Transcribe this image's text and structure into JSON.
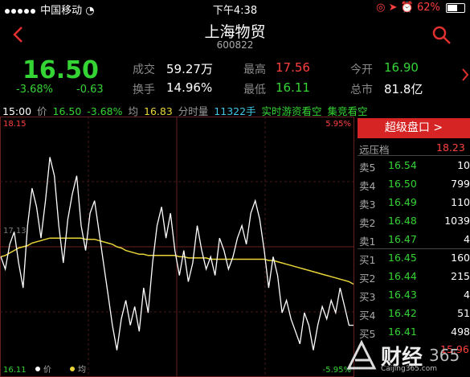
{
  "status_bar": {
    "carrier": "中国移动",
    "time": "下午4:38",
    "battery": "62%"
  },
  "header": {
    "title": "上海物贸",
    "code": "600822"
  },
  "quote": {
    "price": "16.50",
    "change_pct": "-3.68%",
    "change": "-0.63",
    "volume_label": "成交",
    "volume": "59.27万",
    "high_label": "最高",
    "high": "17.56",
    "open_label": "今开",
    "open": "16.90",
    "turnover_label": "换手",
    "turnover": "14.96%",
    "low_label": "最低",
    "low": "16.11",
    "mktcap_label": "总市",
    "mktcap": "81.8亿"
  },
  "info_line": {
    "time": "15:00",
    "price_label": "价",
    "price": "16.50",
    "pct": "-3.68%",
    "avg_label": "均",
    "avg": "16.83",
    "vol_label": "分时量",
    "vol": "11322手",
    "tag1": "实时游资看空",
    "tag2": "集竞看空"
  },
  "chart": {
    "top_left": "18.15",
    "top_right": "5.95%",
    "mid_left": "17.13",
    "bottom_left": "16.11",
    "bottom_right": "-5.95%",
    "legend_price": "价",
    "legend_avg": "均",
    "colors": {
      "price": "#ffffff",
      "avg": "#e8d53a",
      "grid": "#5a1a1a"
    }
  },
  "chart_data": {
    "type": "line",
    "title": "",
    "xlabel": "",
    "ylabel": "",
    "ylim": [
      16.11,
      18.15
    ],
    "series": [
      {
        "name": "价",
        "values": [
          17.05,
          16.95,
          17.15,
          17.25,
          17.0,
          16.8,
          17.3,
          17.6,
          17.45,
          17.2,
          17.5,
          17.85,
          17.7,
          17.3,
          17.0,
          17.35,
          17.55,
          17.7,
          17.3,
          17.1,
          17.4,
          17.5,
          17.25,
          17.0,
          16.75,
          16.5,
          16.3,
          16.55,
          16.7,
          16.5,
          16.65,
          16.45,
          16.8,
          16.6,
          17.0,
          17.3,
          17.45,
          17.2,
          17.4,
          17.1,
          16.9,
          17.1,
          16.85,
          17.0,
          17.3,
          17.1,
          16.95,
          17.05,
          16.9,
          17.2,
          17.1,
          16.95,
          17.05,
          17.2,
          17.3,
          17.15,
          17.4,
          17.5,
          17.35,
          17.1,
          16.8,
          17.05,
          16.9,
          16.6,
          16.7,
          16.55,
          16.45,
          16.35,
          16.6,
          16.5,
          16.3,
          16.5,
          16.65,
          16.55,
          16.7,
          16.6,
          16.8,
          16.65,
          16.5,
          16.5
        ]
      },
      {
        "name": "均",
        "values": [
          17.05,
          17.06,
          17.08,
          17.1,
          17.12,
          17.13,
          17.14,
          17.16,
          17.17,
          17.18,
          17.19,
          17.2,
          17.2,
          17.2,
          17.2,
          17.2,
          17.2,
          17.2,
          17.2,
          17.19,
          17.19,
          17.19,
          17.18,
          17.17,
          17.16,
          17.15,
          17.13,
          17.12,
          17.1,
          17.09,
          17.08,
          17.07,
          17.07,
          17.06,
          17.06,
          17.06,
          17.06,
          17.06,
          17.06,
          17.06,
          17.05,
          17.05,
          17.04,
          17.04,
          17.04,
          17.04,
          17.04,
          17.03,
          17.03,
          17.03,
          17.03,
          17.03,
          17.03,
          17.03,
          17.03,
          17.03,
          17.03,
          17.03,
          17.03,
          17.03,
          17.02,
          17.02,
          17.01,
          17.0,
          16.99,
          16.98,
          16.97,
          16.96,
          16.95,
          16.94,
          16.93,
          16.92,
          16.91,
          16.9,
          16.89,
          16.88,
          16.87,
          16.86,
          16.85,
          16.83
        ]
      }
    ]
  },
  "order_book": {
    "button": "超级盘口 >",
    "prev_label": "远压档",
    "prev_value": "18.23",
    "asks": [
      {
        "label": "卖5",
        "price": "16.54",
        "vol": "10"
      },
      {
        "label": "卖4",
        "price": "16.50",
        "vol": "799"
      },
      {
        "label": "卖3",
        "price": "16.49",
        "vol": "110"
      },
      {
        "label": "卖2",
        "price": "16.48",
        "vol": "1039"
      },
      {
        "label": "卖1",
        "price": "16.47",
        "vol": "4"
      }
    ],
    "bids": [
      {
        "label": "买1",
        "price": "16.45",
        "vol": "160"
      },
      {
        "label": "买2",
        "price": "16.44",
        "vol": "215"
      },
      {
        "label": "买3",
        "price": "16.43",
        "vol": "4"
      },
      {
        "label": "买4",
        "price": "16.42",
        "vol": "51"
      },
      {
        "label": "买5",
        "price": "16.41",
        "vol": "498"
      }
    ],
    "bottom_value": "15.96"
  },
  "watermark": {
    "text": "财经",
    "number": "365",
    "url": "Caijing365.com"
  }
}
